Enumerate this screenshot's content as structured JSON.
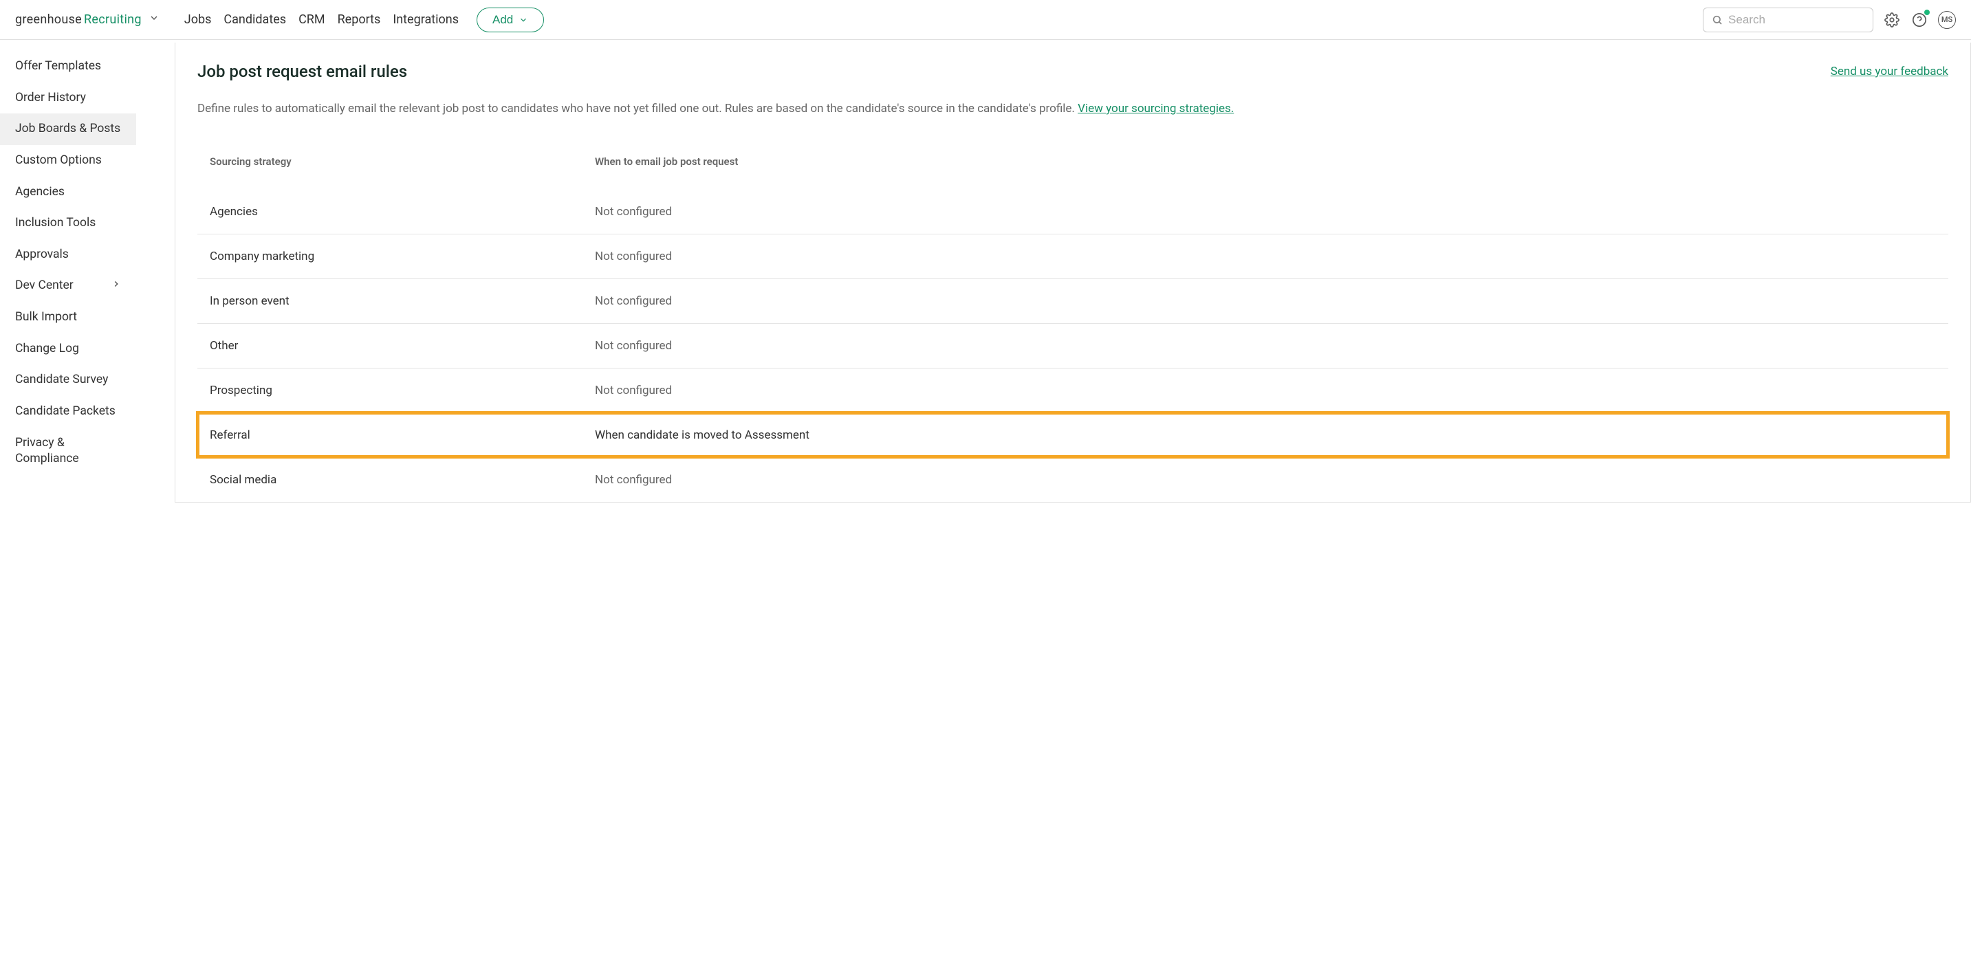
{
  "header": {
    "logo_left": "greenhouse",
    "logo_right": "Recruiting",
    "nav": [
      "Jobs",
      "Candidates",
      "CRM",
      "Reports",
      "Integrations"
    ],
    "add_button": "Add",
    "search_placeholder": "Search",
    "avatar_initials": "MS"
  },
  "sidebar": {
    "items": [
      {
        "label": "Offer Templates",
        "active": false
      },
      {
        "label": "Order History",
        "active": false
      },
      {
        "label": "Job Boards & Posts",
        "active": true
      },
      {
        "label": "Custom Options",
        "active": false
      },
      {
        "label": "Agencies",
        "active": false
      },
      {
        "label": "Inclusion Tools",
        "active": false
      },
      {
        "label": "Approvals",
        "active": false
      },
      {
        "label": "Dev Center",
        "active": false,
        "chevron": true
      },
      {
        "label": "Bulk Import",
        "active": false
      },
      {
        "label": "Change Log",
        "active": false
      },
      {
        "label": "Candidate Survey",
        "active": false
      },
      {
        "label": "Candidate Packets",
        "active": false
      },
      {
        "label": "Privacy & Compliance",
        "active": false
      }
    ]
  },
  "page": {
    "title": "Job post request email rules",
    "feedback": "Send us your feedback",
    "description": "Define rules to automatically email the relevant job post to candidates who have not yet filled one out. Rules are based on the candidate's source in the candidate's profile.",
    "sourcing_link": "View your sourcing strategies."
  },
  "table": {
    "col_strategy": "Sourcing strategy",
    "col_when": "When to email job post request",
    "rows": [
      {
        "strategy": "Agencies",
        "when": "Not configured",
        "configured": false,
        "highlighted": false
      },
      {
        "strategy": "Company marketing",
        "when": "Not configured",
        "configured": false,
        "highlighted": false
      },
      {
        "strategy": "In person event",
        "when": "Not configured",
        "configured": false,
        "highlighted": false
      },
      {
        "strategy": "Other",
        "when": "Not configured",
        "configured": false,
        "highlighted": false
      },
      {
        "strategy": "Prospecting",
        "when": "Not configured",
        "configured": false,
        "highlighted": false
      },
      {
        "strategy": "Referral",
        "when": "When candidate is moved to Assessment",
        "configured": true,
        "highlighted": true
      },
      {
        "strategy": "Social media",
        "when": "Not configured",
        "configured": false,
        "highlighted": false
      }
    ]
  }
}
